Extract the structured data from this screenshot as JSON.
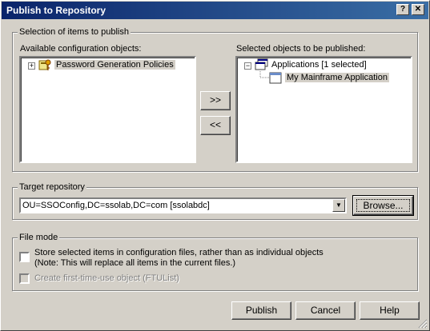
{
  "window": {
    "title": "Publish to Repository",
    "close_glyph": "✕"
  },
  "selection": {
    "group_label": "Selection of items to publish",
    "available_label": "Available configuration objects:",
    "available_items": [
      {
        "label": "Password Generation Policies",
        "expander": "+",
        "icon": "policy-icon"
      }
    ],
    "selected_label": "Selected objects to be published:",
    "selected_root": {
      "label": "Applications [1 selected]",
      "expander": "−",
      "icon": "applications-icon"
    },
    "selected_children": [
      {
        "label": "My Mainframe Application",
        "icon": "application-window-icon"
      }
    ],
    "add_button": ">>",
    "remove_button": "<<"
  },
  "target": {
    "group_label": "Target repository",
    "value": "OU=SSOConfig,DC=ssolab,DC=com [ssolabdc]",
    "browse_button": "Browse..."
  },
  "file_mode": {
    "group_label": "File mode",
    "store_label_line1": "Store selected items in configuration files, rather than as individual objects",
    "store_label_line2": "(Note: This will replace all items in the current files.)",
    "store_checked": false,
    "ftu_label": "Create first-time-use object (FTUList)",
    "ftu_checked": false,
    "ftu_enabled": false
  },
  "footer": {
    "publish_button": "Publish",
    "cancel_button": "Cancel",
    "help_button": "Help"
  }
}
